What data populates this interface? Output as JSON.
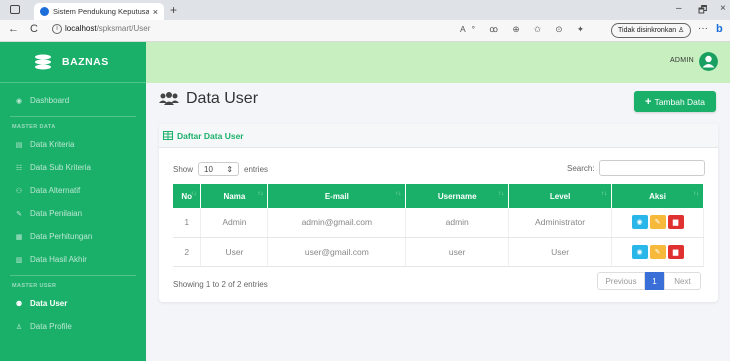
{
  "browser": {
    "tab_title": "Sistem Pendukung Keputusan M",
    "tab_close": "×",
    "new_tab": "+",
    "minimize": "–",
    "restore": "🗗",
    "close": "×",
    "back": "←",
    "reload": "C",
    "url_host": "localhost",
    "url_path": "/spksmart/User",
    "toolbar_icons": "A° ꝏ ⊕ ✩ ⊙ ✦",
    "sync_label": "Tidak disinkronkan",
    "more": "···",
    "bing": "b"
  },
  "sidebar": {
    "brand": "BAZNAS",
    "items": [
      {
        "label": "Dashboard",
        "icon": "◉"
      },
      {
        "section": "MASTER DATA"
      },
      {
        "label": "Data Kriteria",
        "icon": "▤"
      },
      {
        "label": "Data Sub Kriteria",
        "icon": "☷"
      },
      {
        "label": "Data Alternatif",
        "icon": "⚇"
      },
      {
        "label": "Data Penilaian",
        "icon": "✎"
      },
      {
        "label": "Data Perhitungan",
        "icon": "▦"
      },
      {
        "label": "Data Hasil Akhir",
        "icon": "▥"
      },
      {
        "section": "MASTER USER"
      },
      {
        "label": "Data User",
        "icon": "⚉",
        "active": true
      },
      {
        "label": "Data Profile",
        "icon": "♙"
      }
    ]
  },
  "topbar": {
    "user_label": "ADMIN"
  },
  "main": {
    "title": "Data User",
    "add_button": "Tambah Data",
    "card_title": "Daftar Data User",
    "show_label": "Show",
    "show_value": "10",
    "entries_label": "entries",
    "search_label": "Search:",
    "columns": [
      "No",
      "Nama",
      "E-mail",
      "Username",
      "Level",
      "Aksi"
    ],
    "rows": [
      [
        "1",
        "Admin",
        "admin@gmail.com",
        "admin",
        "Administrator"
      ],
      [
        "2",
        "User",
        "user@gmail.com",
        "user",
        "User"
      ]
    ],
    "info_text": "Showing 1 to 2 of 2 entries",
    "pager": {
      "prev": "Previous",
      "current": "1",
      "next": "Next"
    }
  },
  "colors": {
    "accent": "#1bb06a",
    "topbar": "#c8efc0",
    "view": "#29b6e8",
    "edit": "#f6b93b",
    "delete": "#e03131",
    "pager_active": "#3b6fd8"
  }
}
